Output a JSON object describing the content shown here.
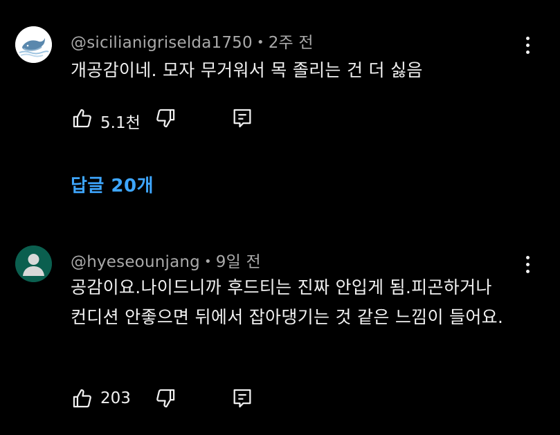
{
  "comments": [
    {
      "author": "@sicilianigriselda1750",
      "separator": "•",
      "time": "2주 전",
      "text": "개공감이네. 모자 무거워서 목 졸리는 건 더 싫음",
      "likes": "5.1천",
      "replies_label": "답글 20개"
    },
    {
      "author": "@hyeseounjang",
      "separator": "•",
      "time": "9일 전",
      "text": "공감이요.나이드니까 후드티는 진짜 안입게 됨.피곤하거나 컨디션 안좋으면 뒤에서 잡아댕기는 것 같은 느낌이 들어요.",
      "likes": "203"
    }
  ],
  "colors": {
    "background": "#000000",
    "meta_text": "#aaaaaa",
    "replies_link": "#3ea6ff",
    "avatar2_bg": "#0b5f4f"
  },
  "icons": [
    "whale-avatar",
    "person-avatar",
    "more-vert-icon",
    "thumb-up-icon",
    "thumb-down-icon",
    "reply-icon"
  ]
}
